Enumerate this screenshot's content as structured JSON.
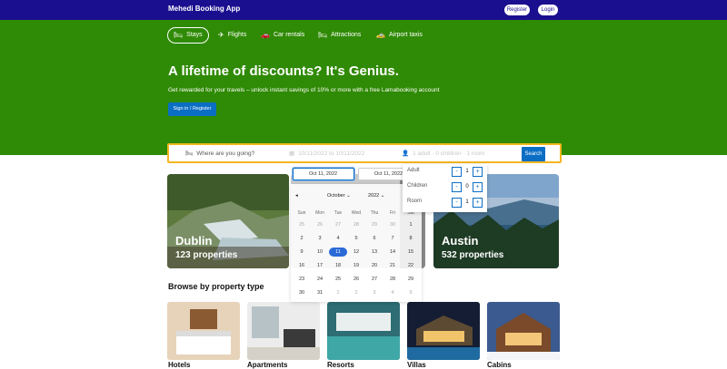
{
  "header": {
    "brand": "Mehedi Booking App",
    "register": "Register",
    "login": "Login"
  },
  "nav": [
    {
      "label": "Stays",
      "icon": "bed-icon"
    },
    {
      "label": "Flights",
      "icon": "plane-icon"
    },
    {
      "label": "Car rentals",
      "icon": "car-icon"
    },
    {
      "label": "Attractions",
      "icon": "bed-icon"
    },
    {
      "label": "Airport taxis",
      "icon": "taxi-icon"
    }
  ],
  "hero": {
    "title": "A lifetime of discounts? It's Genius.",
    "subtitle": "Get rewarded for your travels – unlock instant savings of 10% or more with a free Lamabooking account",
    "signin": "Sign in / Register"
  },
  "search": {
    "destination_placeholder": "Where are you going?",
    "dates": "10/11/2022 to 10/11/2022",
    "guests": "1 adult · 0 children · 1 room",
    "button": "Search"
  },
  "datepicker": {
    "start": "Oct 11, 2022",
    "end": "Oct 11, 2022",
    "month": "October",
    "year": "2022",
    "weekdays": [
      "Sun",
      "Mon",
      "Tue",
      "Wed",
      "Thu",
      "Fri",
      "Sat"
    ],
    "weeks": [
      [
        "25",
        "26",
        "27",
        "28",
        "29",
        "30",
        "1"
      ],
      [
        "2",
        "3",
        "4",
        "5",
        "6",
        "7",
        "8"
      ],
      [
        "9",
        "10",
        "11",
        "12",
        "13",
        "14",
        "15"
      ],
      [
        "16",
        "17",
        "18",
        "19",
        "20",
        "21",
        "22"
      ],
      [
        "23",
        "24",
        "25",
        "26",
        "27",
        "28",
        "29"
      ],
      [
        "30",
        "31",
        "1",
        "2",
        "3",
        "4",
        "5"
      ]
    ]
  },
  "options": [
    {
      "label": "Adult",
      "value": "1"
    },
    {
      "label": "Children",
      "value": "0"
    },
    {
      "label": "Room",
      "value": "1"
    }
  ],
  "cities": [
    {
      "name": "Dublin",
      "count": "123 properties"
    },
    {
      "name": "Austin",
      "count": "532 properties"
    }
  ],
  "browse": {
    "title": "Browse by property type"
  },
  "property_types": [
    "Hotels",
    "Apartments",
    "Resorts",
    "Villas",
    "Cabins"
  ],
  "colors": {
    "header": "#1a0f8f",
    "hero": "#2f8a05",
    "accent": "#0b6ec5",
    "search_border": "#f3b61f"
  }
}
